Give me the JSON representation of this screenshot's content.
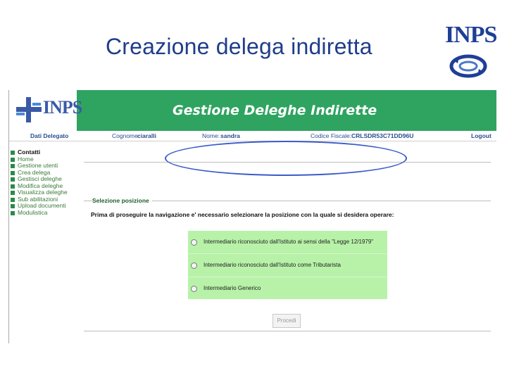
{
  "slide": {
    "title": "Creazione delega indiretta",
    "corner_logo": "INPS"
  },
  "header": {
    "logo_text": "INPS",
    "app_title": "Gestione Deleghe Indirette",
    "accent_color": "#2fa360"
  },
  "infobar": {
    "dati_delegato": "Dati Delegato",
    "cognome_label": "Cognome:",
    "cognome_value": "ciaralli",
    "nome_label": "Nome:",
    "nome_value": "sandra",
    "cf_label": "Codice Fiscale:",
    "cf_value": "CRLSDR53C71DD96U",
    "logout": "Logout"
  },
  "sidebar": {
    "items": [
      {
        "label": "Contatti"
      },
      {
        "label": "Home"
      },
      {
        "label": "Gestione utenti"
      },
      {
        "label": "Crea delega"
      },
      {
        "label": "Gestisci deleghe"
      },
      {
        "label": "Modifica deleghe"
      },
      {
        "label": "Visualizza deleghe"
      },
      {
        "label": "Sub abilitazioni"
      },
      {
        "label": "Upload documenti"
      },
      {
        "label": "Modulistica"
      }
    ]
  },
  "main": {
    "section_label": "Selezione posizione",
    "prompt": "Prima di proseguire la navigazione e' necessario selezionare la posizione con la quale si desidera operare:",
    "options": [
      {
        "label": "Intermediario riconosciuto dall'Istituto ai sensi della \"Legge 12/1979\"",
        "selected": false
      },
      {
        "label": "Intermediario riconosciuto dall'Istituto come Tributarista",
        "selected": false
      },
      {
        "label": "Intermediario Generico",
        "selected": false
      }
    ],
    "options_bg": "#b7f2a8",
    "proceed_label": "Procedi"
  }
}
